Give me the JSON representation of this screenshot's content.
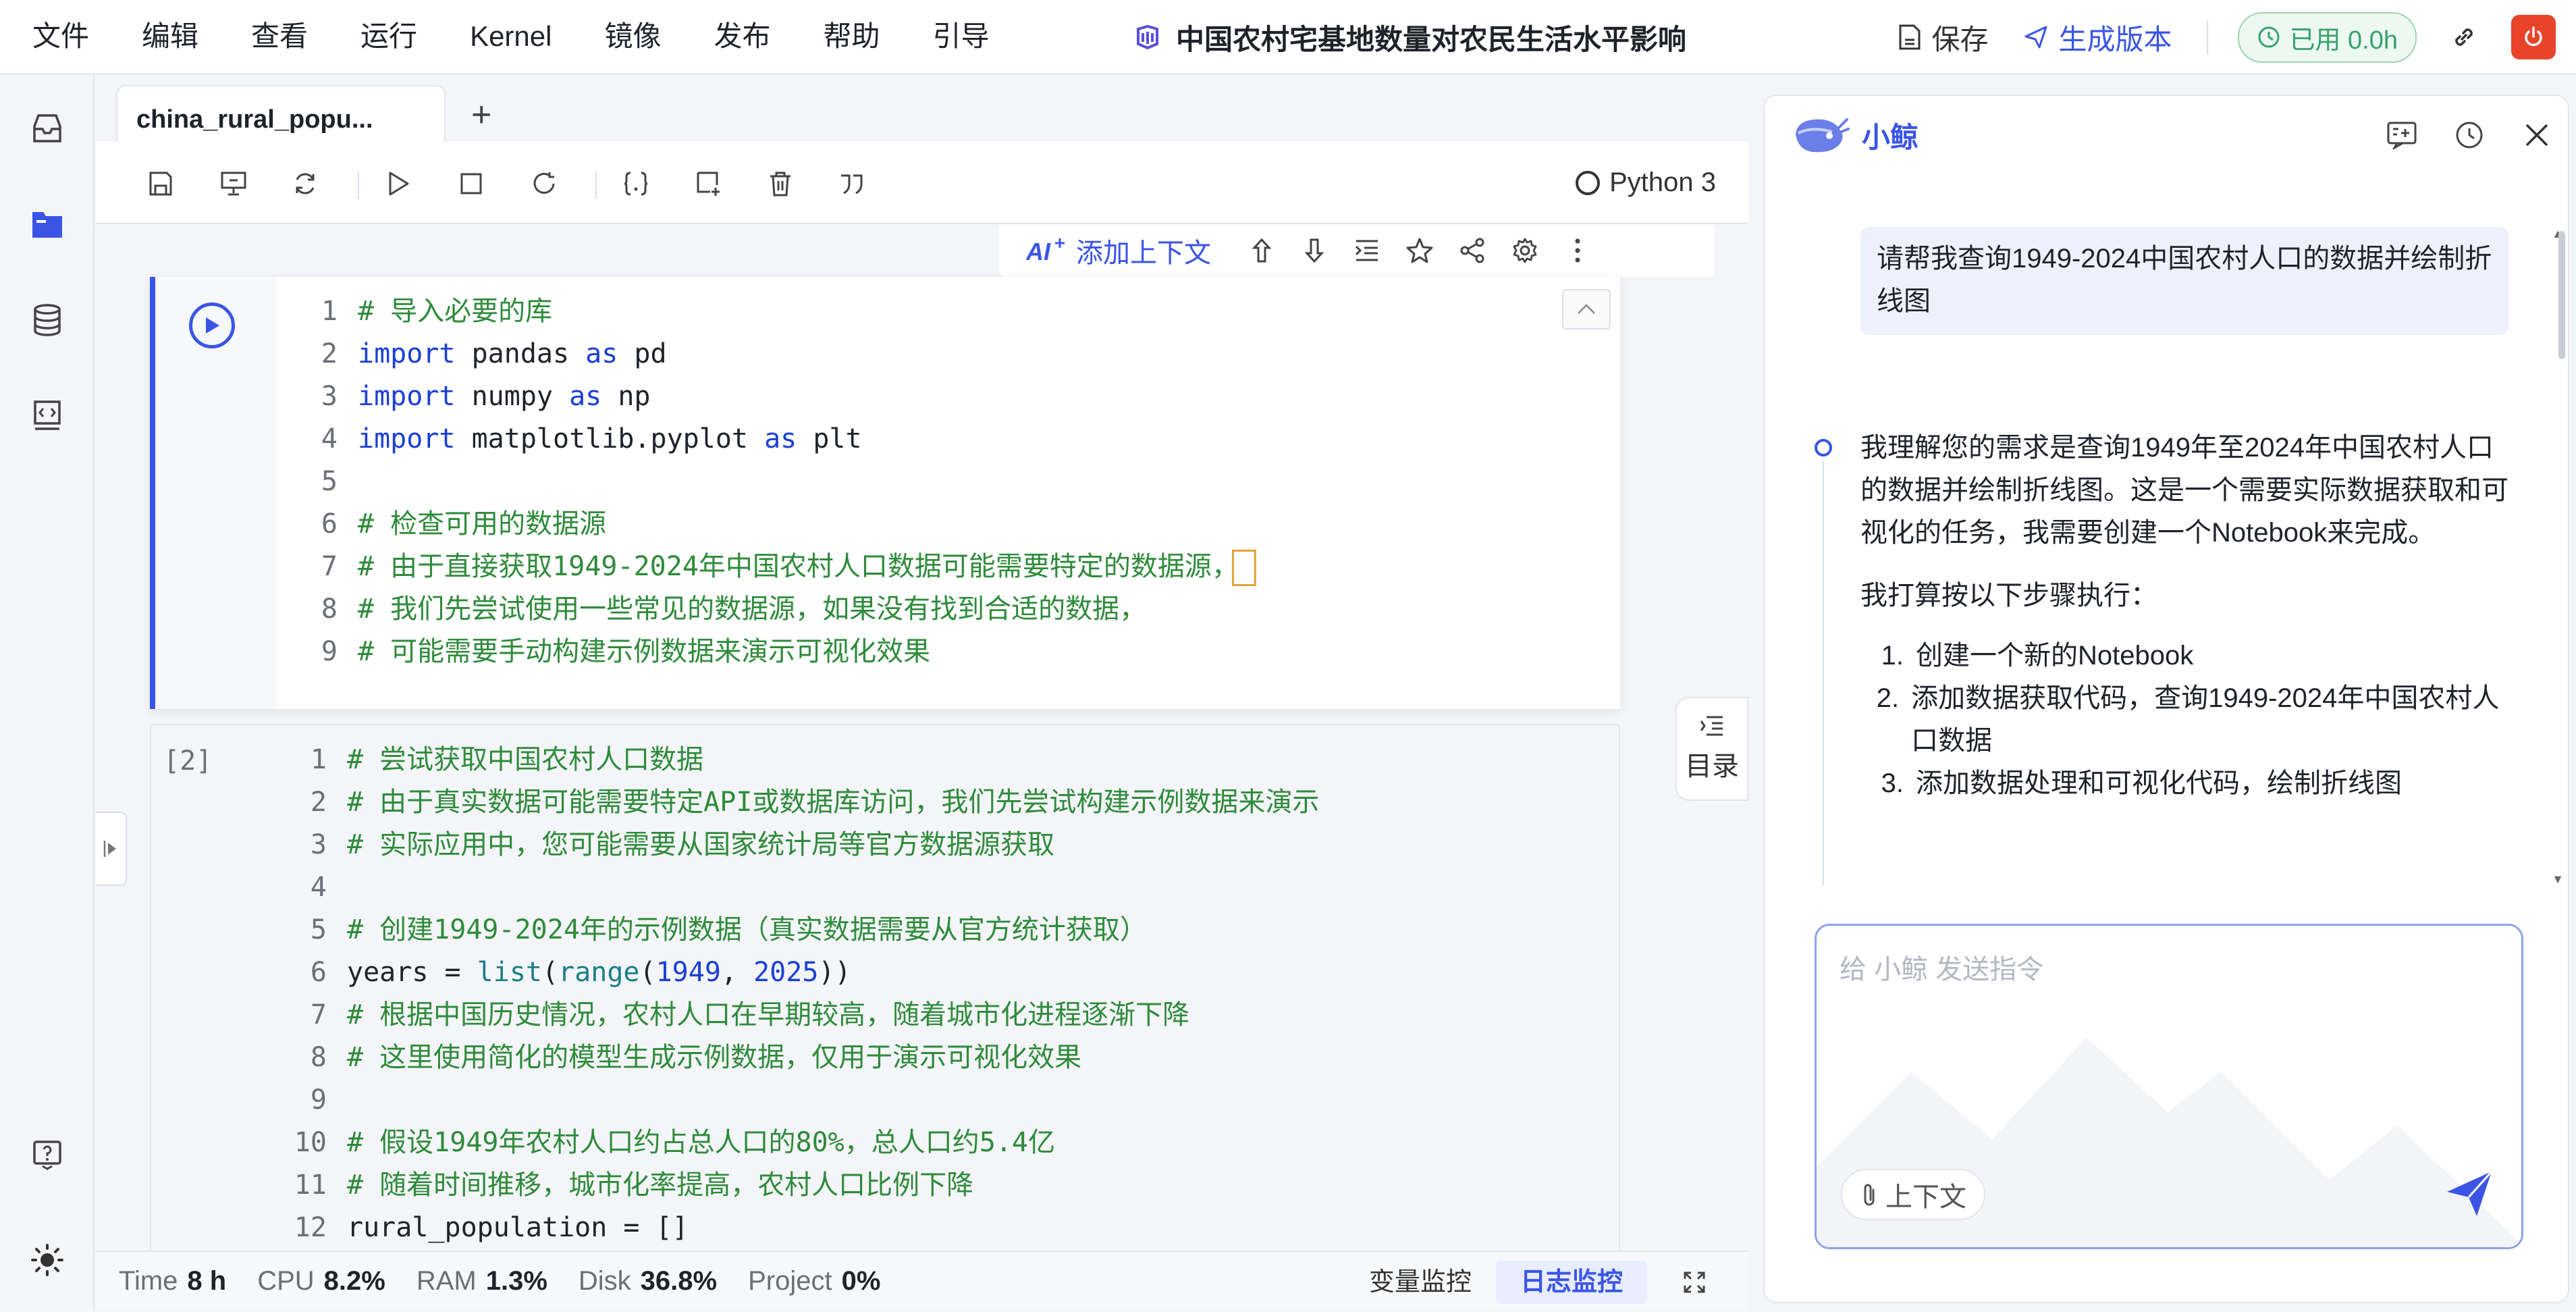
{
  "menu": [
    "文件",
    "编辑",
    "查看",
    "运行",
    "Kernel",
    "镜像",
    "发布",
    "帮助",
    "引导"
  ],
  "doc_title": "中国农村宅基地数量对农民生活水平影响",
  "top_right": {
    "save_label": "保存",
    "generate_label": "生成版本",
    "usage_label": "已用 0.0h"
  },
  "tab": {
    "name": "china_rural_popu...",
    "add": "+"
  },
  "kernel": {
    "name": "Python 3"
  },
  "cell_tools": {
    "ai_label": "添加上下文"
  },
  "cell1": {
    "lines": [
      "1",
      "2",
      "3",
      "4",
      "5",
      "6",
      "7",
      "8",
      "9"
    ]
  },
  "cell2": {
    "exec_count": "[2]",
    "lines": [
      "1",
      "2",
      "3",
      "4",
      "5",
      "6",
      "7",
      "8",
      "9",
      "10",
      "11",
      "12"
    ]
  },
  "toc_label": "目录",
  "status": {
    "time_label": "Time",
    "time_value": "8 h",
    "cpu_label": "CPU",
    "cpu_value": "8.2%",
    "ram_label": "RAM",
    "ram_value": "1.3%",
    "disk_label": "Disk",
    "disk_value": "36.8%",
    "project_label": "Project",
    "project_value": "0%",
    "var_monitor": "变量监控",
    "log_monitor": "日志监控"
  },
  "assistant": {
    "name": "小鲸",
    "user_message": "请帮我查询1949-2024中国农村人口的数据并绘制折线图",
    "bot_intro": "我理解您的需求是查询1949年至2024年中国农村人口的数据并绘制折线图。这是一个需要实际数据获取和可视化的任务，我需要创建一个Notebook来完成。",
    "bot_plan": "我打算按以下步骤执行：",
    "steps": [
      "创建一个新的Notebook",
      "添加数据获取代码，查询1949-2024年中国农村人口数据",
      "添加数据处理和可视化代码，绘制折线图"
    ],
    "input_placeholder": "给 小鲸 发送指令",
    "context_label": "上下文"
  },
  "colors": {
    "accent": "#3a55e6",
    "comment": "#2e8b3a",
    "keyword": "#1a3fd6",
    "danger": "#e8442a",
    "success": "#35a36b"
  }
}
